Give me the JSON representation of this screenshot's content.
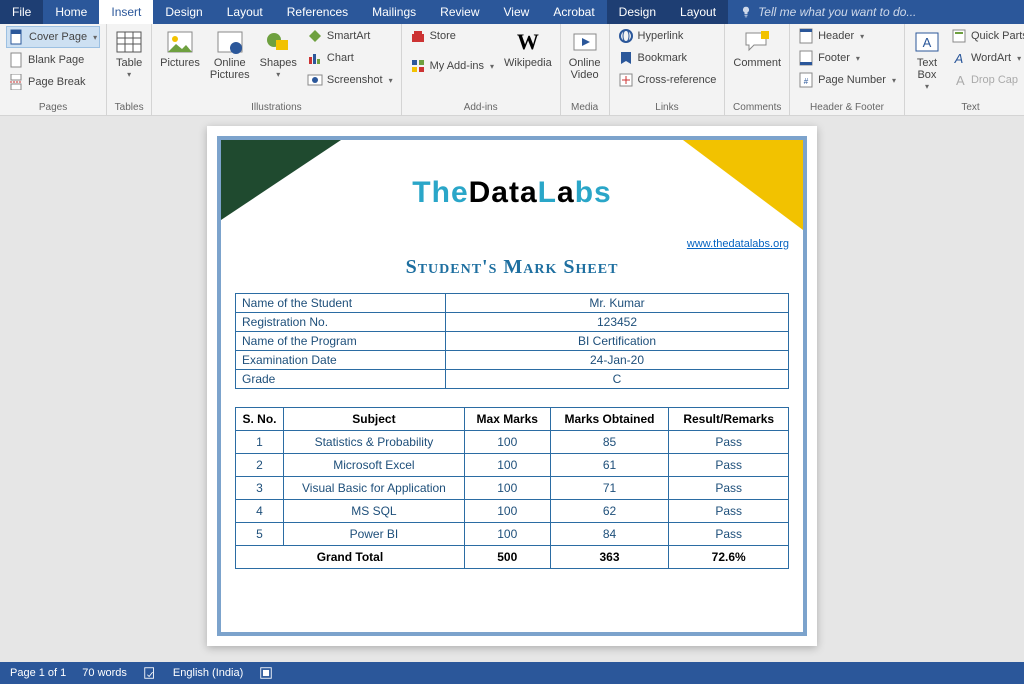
{
  "menu": {
    "file": "File",
    "home": "Home",
    "insert": "Insert",
    "design": "Design",
    "layout": "Layout",
    "references": "References",
    "mailings": "Mailings",
    "review": "Review",
    "view": "View",
    "acrobat": "Acrobat",
    "ctx_design": "Design",
    "ctx_layout": "Layout",
    "tellme": "Tell me what you want to do..."
  },
  "ribbon": {
    "pages": {
      "label": "Pages",
      "cover": "Cover Page",
      "blank": "Blank Page",
      "break": "Page Break"
    },
    "tables": {
      "label": "Tables",
      "table": "Table"
    },
    "illustrations": {
      "label": "Illustrations",
      "pictures": "Pictures",
      "online_pictures": "Online\nPictures",
      "shapes": "Shapes",
      "smartart": "SmartArt",
      "chart": "Chart",
      "screenshot": "Screenshot"
    },
    "addins": {
      "label": "Add-ins",
      "store": "Store",
      "myaddins": "My Add-ins",
      "wikipedia": "Wikipedia"
    },
    "media": {
      "label": "Media",
      "video": "Online\nVideo"
    },
    "links": {
      "label": "Links",
      "hyperlink": "Hyperlink",
      "bookmark": "Bookmark",
      "crossref": "Cross-reference"
    },
    "comments": {
      "label": "Comments",
      "comment": "Comment"
    },
    "headerfooter": {
      "label": "Header & Footer",
      "header": "Header",
      "footer": "Footer",
      "pagenum": "Page Number"
    },
    "text": {
      "label": "Text",
      "textbox": "Text\nBox",
      "quickparts": "Quick Parts",
      "wordart": "WordArt",
      "dropcap": "Drop Cap"
    }
  },
  "doc": {
    "logo": {
      "p1": "The",
      "p2": "Data",
      "p3": "L",
      "p4": "a",
      "p5": "bs"
    },
    "url": "www.thedatalabs.org",
    "title": "Student's Mark Sheet",
    "info": [
      {
        "k": "Name of the Student",
        "v": "Mr. Kumar"
      },
      {
        "k": "Registration No.",
        "v": "123452"
      },
      {
        "k": "Name of the Program",
        "v": "BI Certification"
      },
      {
        "k": "Examination Date",
        "v": "24-Jan-20"
      },
      {
        "k": "Grade",
        "v": "C"
      }
    ],
    "marks": {
      "head": [
        "S. No.",
        "Subject",
        "Max Marks",
        "Marks Obtained",
        "Result/Remarks"
      ],
      "rows": [
        {
          "n": "1",
          "subj": "Statistics & Probability",
          "max": "100",
          "obt": "85",
          "res": "Pass"
        },
        {
          "n": "2",
          "subj": "Microsoft Excel",
          "max": "100",
          "obt": "61",
          "res": "Pass"
        },
        {
          "n": "3",
          "subj": "Visual Basic for Application",
          "max": "100",
          "obt": "71",
          "res": "Pass"
        },
        {
          "n": "4",
          "subj": "MS SQL",
          "max": "100",
          "obt": "62",
          "res": "Pass"
        },
        {
          "n": "5",
          "subj": "Power BI",
          "max": "100",
          "obt": "84",
          "res": "Pass"
        }
      ],
      "total": {
        "label": "Grand Total",
        "max": "500",
        "obt": "363",
        "pct": "72.6%"
      }
    }
  },
  "status": {
    "page": "Page 1 of 1",
    "words": "70 words",
    "lang": "English (India)"
  }
}
